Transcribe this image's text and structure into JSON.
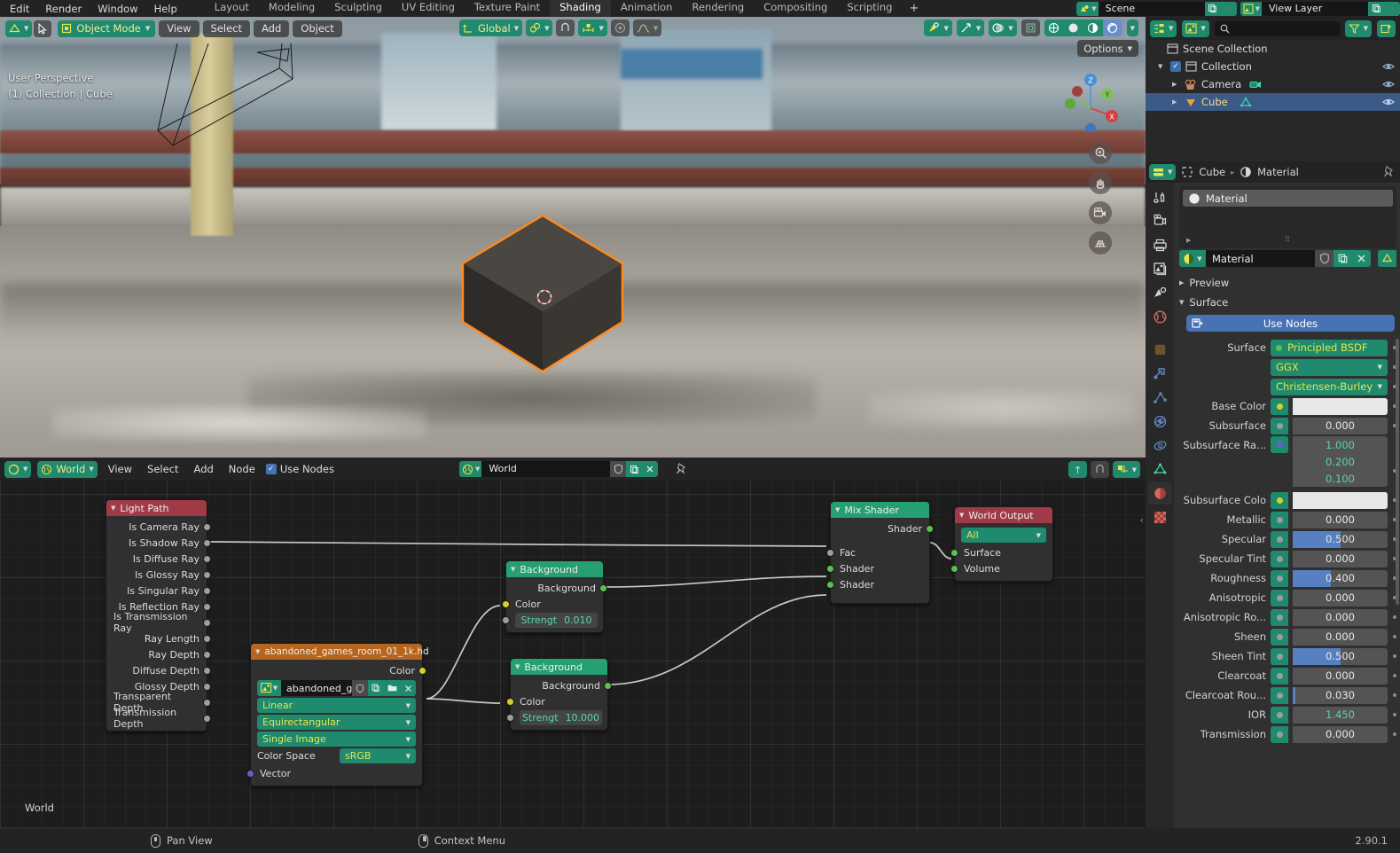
{
  "topbar": {
    "menus": [
      "Edit",
      "Render",
      "Window",
      "Help"
    ],
    "workspaces": [
      {
        "label": "Layout",
        "active": false
      },
      {
        "label": "Modeling",
        "active": false
      },
      {
        "label": "Sculpting",
        "active": false
      },
      {
        "label": "UV Editing",
        "active": false
      },
      {
        "label": "Texture Paint",
        "active": false
      },
      {
        "label": "Shading",
        "active": true
      },
      {
        "label": "Animation",
        "active": false
      },
      {
        "label": "Rendering",
        "active": false
      },
      {
        "label": "Compositing",
        "active": false
      },
      {
        "label": "Scripting",
        "active": false
      }
    ],
    "add_workspace": "+",
    "scene_name": "Scene",
    "view_layer_name": "View Layer"
  },
  "viewport": {
    "mode": "Object Mode",
    "menus": [
      "View",
      "Select",
      "Add",
      "Object"
    ],
    "transform_orientation": "Global",
    "options_label": "Options",
    "overlay_line1": "User Perspective",
    "overlay_line2": "(1) Collection | Cube",
    "gizmo_axes": [
      "X",
      "Y",
      "Z"
    ]
  },
  "shader_editor": {
    "id_type": "World",
    "menus": [
      "View",
      "Select",
      "Add",
      "Node"
    ],
    "use_nodes_label": "Use Nodes",
    "use_nodes_checked": true,
    "world_datablock": "World",
    "canvas_label": "World"
  },
  "nodes": {
    "light_path": {
      "title": "Light Path",
      "header_color": "#a03a46",
      "outputs": [
        "Is Camera Ray",
        "Is Shadow Ray",
        "Is Diffuse Ray",
        "Is Glossy Ray",
        "Is Singular Ray",
        "Is Reflection Ray",
        "Is Transmission Ray",
        "Ray Length",
        "Ray Depth",
        "Diffuse Depth",
        "Glossy Depth",
        "Transparent Depth",
        "Transmission Depth"
      ]
    },
    "env_texture": {
      "title": "abandoned_games_room_01_1k.hd",
      "header_color": "#b5651d",
      "output": "Color",
      "image_name": "abandoned_ga...",
      "interpolation": "Linear",
      "projection": "Equirectangular",
      "source": "Single Image",
      "colorspace_label": "Color Space",
      "colorspace_value": "sRGB",
      "input": "Vector"
    },
    "background_1": {
      "title": "Background",
      "header_color": "#26a072",
      "output": "Background",
      "color_label": "Color",
      "strength_label": "Strengt",
      "strength_value": "0.010"
    },
    "background_2": {
      "title": "Background",
      "header_color": "#26a072",
      "output": "Background",
      "color_label": "Color",
      "strength_label": "Strengt",
      "strength_value": "10.000"
    },
    "mix_shader": {
      "title": "Mix Shader",
      "header_color": "#26a072",
      "output": "Shader",
      "inputs": [
        "Fac",
        "Shader",
        "Shader"
      ]
    },
    "world_output": {
      "title": "World Output",
      "header_color": "#a03a46",
      "target": "All",
      "inputs": [
        "Surface",
        "Volume"
      ]
    }
  },
  "outliner": {
    "search_placeholder": "",
    "rows": [
      {
        "label": "Scene Collection",
        "indent": 0,
        "icon": "collection-icon",
        "selected": false,
        "has_tri": false,
        "has_check": false,
        "has_eye": false
      },
      {
        "label": "Collection",
        "indent": 1,
        "icon": "collection-icon",
        "selected": false,
        "has_tri": true,
        "has_check": true,
        "has_eye": true
      },
      {
        "label": "Camera",
        "indent": 2,
        "icon": "camera-object-icon",
        "selected": false,
        "has_tri": true,
        "has_check": false,
        "has_eye": true
      },
      {
        "label": "Cube",
        "indent": 2,
        "icon": "mesh-object-icon",
        "selected": true,
        "has_tri": true,
        "has_check": false,
        "has_eye": true
      }
    ]
  },
  "properties": {
    "breadcrumb_object": "Cube",
    "breadcrumb_material": "Material",
    "material_slot": "Material",
    "material_datablock": "Material",
    "panels": [
      {
        "label": "Preview",
        "open": false
      },
      {
        "label": "Surface",
        "open": true
      }
    ],
    "use_nodes_label": "Use Nodes",
    "surface_label": "Surface",
    "surface_value": "Principled BSDF",
    "distribution": "GGX",
    "subsurface_method": "Christensen-Burley",
    "rows": [
      {
        "label": "Base Color",
        "type": "color",
        "value": "",
        "dot": "#d6cf2a",
        "color": "#e8e8e8"
      },
      {
        "label": "Subsurface",
        "type": "slider",
        "value": "0.000",
        "fill": 0,
        "dot": "#9d9d9d"
      },
      {
        "label": "Subsurface Ra...",
        "type": "vector",
        "values": [
          "1.000",
          "0.200",
          "0.100"
        ],
        "dot": "#6363c7"
      },
      {
        "label": "Subsurface Colo",
        "type": "color",
        "value": "",
        "dot": "#d6cf2a",
        "color": "#e8e8e8"
      },
      {
        "label": "Metallic",
        "type": "slider",
        "value": "0.000",
        "fill": 0,
        "dot": "#9d9d9d"
      },
      {
        "label": "Specular",
        "type": "slider",
        "value": "0.500",
        "fill": 50,
        "dot": "#9d9d9d"
      },
      {
        "label": "Specular Tint",
        "type": "slider",
        "value": "0.000",
        "fill": 0,
        "dot": "#9d9d9d"
      },
      {
        "label": "Roughness",
        "type": "slider",
        "value": "0.400",
        "fill": 40,
        "dot": "#9d9d9d"
      },
      {
        "label": "Anisotropic",
        "type": "slider",
        "value": "0.000",
        "fill": 0,
        "dot": "#9d9d9d"
      },
      {
        "label": "Anisotropic Ro...",
        "type": "slider",
        "value": "0.000",
        "fill": 0,
        "dot": "#9d9d9d"
      },
      {
        "label": "Sheen",
        "type": "slider",
        "value": "0.000",
        "fill": 0,
        "dot": "#9d9d9d"
      },
      {
        "label": "Sheen Tint",
        "type": "slider",
        "value": "0.500",
        "fill": 50,
        "dot": "#9d9d9d"
      },
      {
        "label": "Clearcoat",
        "type": "slider",
        "value": "0.000",
        "fill": 0,
        "dot": "#9d9d9d"
      },
      {
        "label": "Clearcoat Rou...",
        "type": "slider",
        "value": "0.030",
        "fill": 3,
        "dot": "#9d9d9d"
      },
      {
        "label": "IOR",
        "type": "value",
        "value": "1.450",
        "dot": "#9d9d9d"
      },
      {
        "label": "Transmission",
        "type": "slider",
        "value": "0.000",
        "fill": 0,
        "dot": "#9d9d9d"
      }
    ]
  },
  "statusbar": {
    "items": [
      {
        "icon": "mouse-middle-icon",
        "label": "Pan View"
      },
      {
        "icon": "mouse-right-icon",
        "label": "Context Menu"
      }
    ],
    "version": "2.90.1"
  }
}
